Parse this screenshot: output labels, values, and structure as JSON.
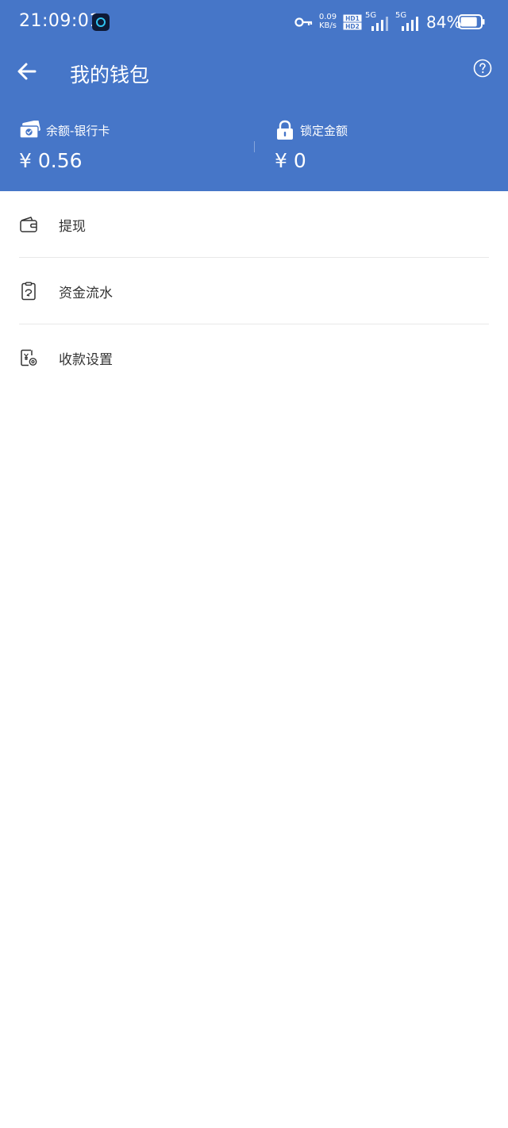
{
  "status_bar": {
    "time": "21:09:01",
    "net_speed_value": "0.09",
    "net_speed_unit": "KB/s",
    "signal1_label": "5G",
    "signal2_label": "5G",
    "battery_percent": "84%",
    "battery_level": 0.84
  },
  "nav": {
    "title": "我的钱包"
  },
  "balance": {
    "bank_label": "余额-银行卡",
    "bank_value": "¥ 0.56",
    "locked_label": "锁定金额",
    "locked_value": "¥ 0"
  },
  "menu": {
    "items": [
      {
        "label": "提现",
        "icon": "wallet-icon"
      },
      {
        "label": "资金流水",
        "icon": "statement-icon"
      },
      {
        "label": "收款设置",
        "icon": "payment-settings-icon"
      }
    ]
  },
  "colors": {
    "header_bg": "#4676c8",
    "page_bg": "#ffffff",
    "text_primary": "#333333",
    "separator": "#e8e8e8"
  }
}
